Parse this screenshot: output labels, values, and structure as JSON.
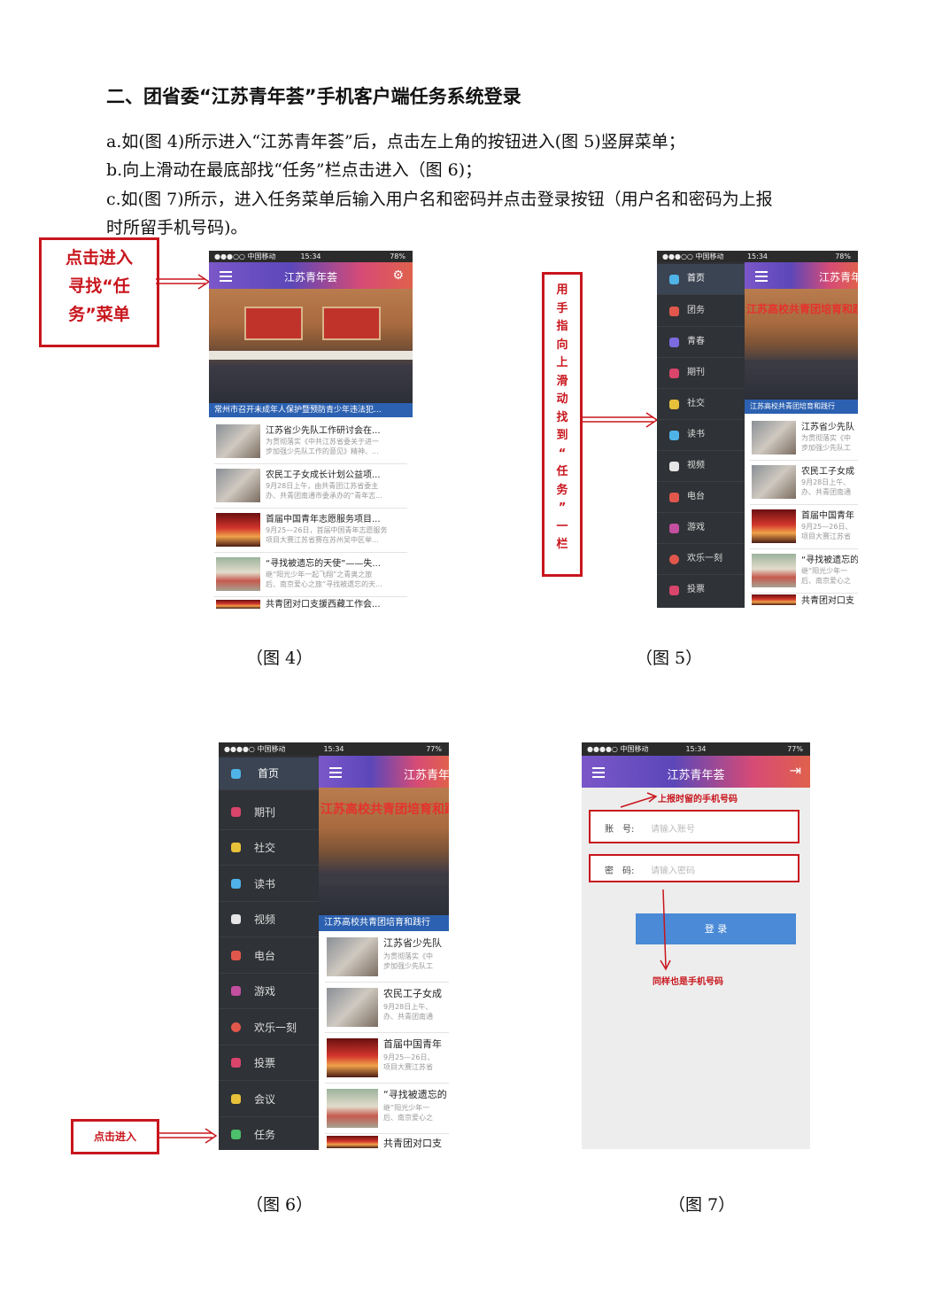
{
  "heading": "二、团省委“江苏青年荟”手机客户端任务系统登录",
  "paragraphs": [
    "a.如(图 4)所示进入“江苏青年荟”后，点击左上角的按钮进入(图 5)竖屏菜单；",
    "b.向上滑动在最底部找“任务”栏点击进入（图 6)；",
    "c.如(图 7)所示，进入任务菜单后输入用户名和密码并点击登录按钮（用户名和密码为上报",
    "时所留手机号码)。"
  ],
  "captions": {
    "fig4": "（图 4）",
    "fig5": "（图 5）",
    "fig6": "（图 6）",
    "fig7": "（图 7）"
  },
  "annotations": {
    "fig4_note": [
      "点击进入",
      "寻找“任",
      "务”菜单"
    ],
    "fig5_note": [
      "用",
      "手",
      "指",
      "向",
      "上",
      "滑",
      "动",
      "找",
      "到",
      "“",
      "任",
      "务",
      "”",
      "一",
      "栏"
    ],
    "fig6_note": "点击进入",
    "fig7_note_top": "上报时留的手机号码",
    "fig7_note_bottom": "同样也是手机号码"
  },
  "status": {
    "carrier4": "●●●○○ 中国移动 ",
    "carrier7": "●●●●○ 中国移动 ",
    "time": "15:34",
    "battery_a": "78%",
    "battery_b": "77%"
  },
  "app_title": "江苏青年荟",
  "app_title_cut": "江苏青年",
  "fig4_banner_caption": "常州市召开未成年人保护暨预防青少年违法犯...",
  "cut_banner_caption": "江苏高校共青团培育和践行",
  "news": [
    {
      "title": "江苏省少先队工作研讨会在...",
      "desc1": "为贯彻落实《中共江苏省委关于进一",
      "desc2": "步加强少先队工作的意见》精神、..."
    },
    {
      "title": "农民工子女成长计划公益项...",
      "desc1": "9月28日上午，由共青团江苏省委主",
      "desc2": "办、共青团南通市委承办的“青年志..."
    },
    {
      "title": "首届中国青年志愿服务项目...",
      "desc1": "9月25—26日，首届中国青年志愿服务",
      "desc2": "项目大赛江苏省赛在苏州吴中区举..."
    },
    {
      "title": "“寻找被遗忘的天使”——失...",
      "desc1": "继“阳光少年一起飞翔”之青奥之旅",
      "desc2": "后、南京爱心之旅“寻找被遗忘的天..."
    },
    {
      "title": "共青团对口支援西藏工作会...",
      "desc1": "",
      "desc2": ""
    }
  ],
  "news_cut": [
    {
      "title": "江苏省少先队",
      "desc1": "为贯彻落实《中",
      "desc2": "步加强少先队工"
    },
    {
      "title": "农民工子女成",
      "desc1": "9月28日上午、",
      "desc2": "办、共青团南通"
    },
    {
      "title": "首届中国青年",
      "desc1": "9月25—26日、",
      "desc2": "项目大赛江苏省"
    },
    {
      "title": "“寻找被遗忘的",
      "desc1": "继“阳光少年一",
      "desc2": "后、南京爱心之"
    },
    {
      "title": "共青团对口支",
      "desc1": "",
      "desc2": ""
    }
  ],
  "menu5": [
    "首页",
    "团务",
    "青春",
    "期刊",
    "社交",
    "读书",
    "视频",
    "电台",
    "游戏",
    "欢乐一刻",
    "投票"
  ],
  "menu6": [
    "首页",
    "期刊",
    "社交",
    "读书",
    "视频",
    "电台",
    "游戏",
    "欢乐一刻",
    "投票",
    "会议",
    "任务"
  ],
  "menu_colors": [
    "#4fb3e8",
    "#e2574c",
    "#7c6ae0",
    "#d9456b",
    "#e8c13a",
    "#4fb3e8",
    "#e6e6e6",
    "#e2574c",
    "#c24fa0",
    "#e2574c",
    "#d9456b",
    "#e8c13a",
    "#4cc06a"
  ],
  "banner_slogan": "江苏高校共青团培育和践行社会主义",
  "login": {
    "account_label": "账　号:",
    "account_placeholder": "请输入账号",
    "password_label": "密　码:",
    "password_placeholder": "请输入密码",
    "button": "登 录"
  }
}
